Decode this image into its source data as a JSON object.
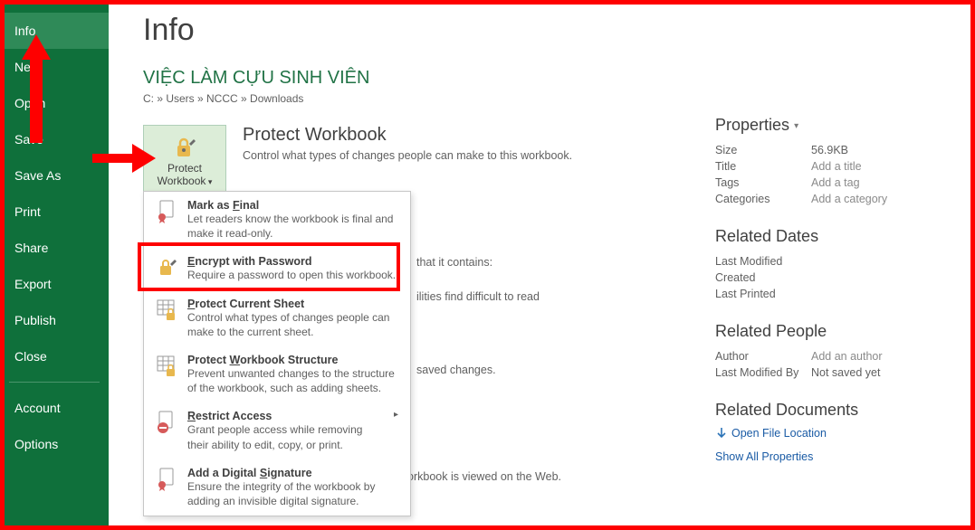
{
  "sidebar": {
    "items": [
      {
        "label": "Info",
        "selected": true
      },
      {
        "label": "New"
      },
      {
        "label": "Open"
      },
      {
        "label": "Save"
      },
      {
        "label": "Save As"
      },
      {
        "label": "Print"
      },
      {
        "label": "Share"
      },
      {
        "label": "Export"
      },
      {
        "label": "Publish"
      },
      {
        "label": "Close"
      }
    ],
    "footer": [
      {
        "label": "Account"
      },
      {
        "label": "Options"
      }
    ]
  },
  "page": {
    "title": "Info",
    "doc_title": "VIỆC LÀM CỰU SINH VIÊN",
    "breadcrumb": "C: » Users » NCCC » Downloads"
  },
  "protect": {
    "button_line1": "Protect",
    "button_line2": "Workbook",
    "heading": "Protect Workbook",
    "desc": "Control what types of changes people can make to this workbook."
  },
  "dropdown": [
    {
      "title_pre": "Mark as ",
      "title_u": "F",
      "title_post": "inal",
      "desc": "Let readers know the workbook is final and make it read-only.",
      "icon": "ribbon"
    },
    {
      "title_pre": "",
      "title_u": "E",
      "title_post": "ncrypt with Password",
      "desc": "Require a password to open this workbook.",
      "icon": "lock"
    },
    {
      "title_pre": "",
      "title_u": "P",
      "title_post": "rotect Current Sheet",
      "desc": "Control what types of changes people can make to the current sheet.",
      "icon": "sheet"
    },
    {
      "title_pre": "Protect ",
      "title_u": "W",
      "title_post": "orkbook Structure",
      "desc": "Prevent unwanted changes to the structure of the workbook, such as adding sheets.",
      "icon": "sheet"
    },
    {
      "title_pre": "",
      "title_u": "R",
      "title_post": "estrict Access",
      "desc": "Grant people access while removing their ability to edit, copy, or print.",
      "icon": "noentry",
      "arrow": true
    },
    {
      "title_pre": "Add a Digital ",
      "title_u": "S",
      "title_post": "ignature",
      "desc": "Ensure the integrity of the workbook by adding an invisible digital signature.",
      "icon": "ribbon"
    }
  ],
  "behind": {
    "line_contains": "that it contains:",
    "line_difficulties": "ilities find difficult to read",
    "line_unsaved": "saved changes.",
    "line_web": "orkbook is viewed on the Web."
  },
  "properties": {
    "heading": "Properties",
    "rows": [
      {
        "label": "Size",
        "value": "56.9KB",
        "link": false
      },
      {
        "label": "Title",
        "value": "Add a title",
        "link": true
      },
      {
        "label": "Tags",
        "value": "Add a tag",
        "link": true
      },
      {
        "label": "Categories",
        "value": "Add a category",
        "link": true
      }
    ]
  },
  "related_dates": {
    "heading": "Related Dates",
    "rows": [
      {
        "label": "Last Modified",
        "value": ""
      },
      {
        "label": "Created",
        "value": ""
      },
      {
        "label": "Last Printed",
        "value": ""
      }
    ]
  },
  "related_people": {
    "heading": "Related People",
    "rows": [
      {
        "label": "Author",
        "value": "Add an author",
        "link": true
      },
      {
        "label": "Last Modified By",
        "value": "Not saved yet",
        "link": false
      }
    ]
  },
  "related_docs": {
    "heading": "Related Documents",
    "open_location": "Open File Location",
    "show_all": "Show All Properties"
  }
}
